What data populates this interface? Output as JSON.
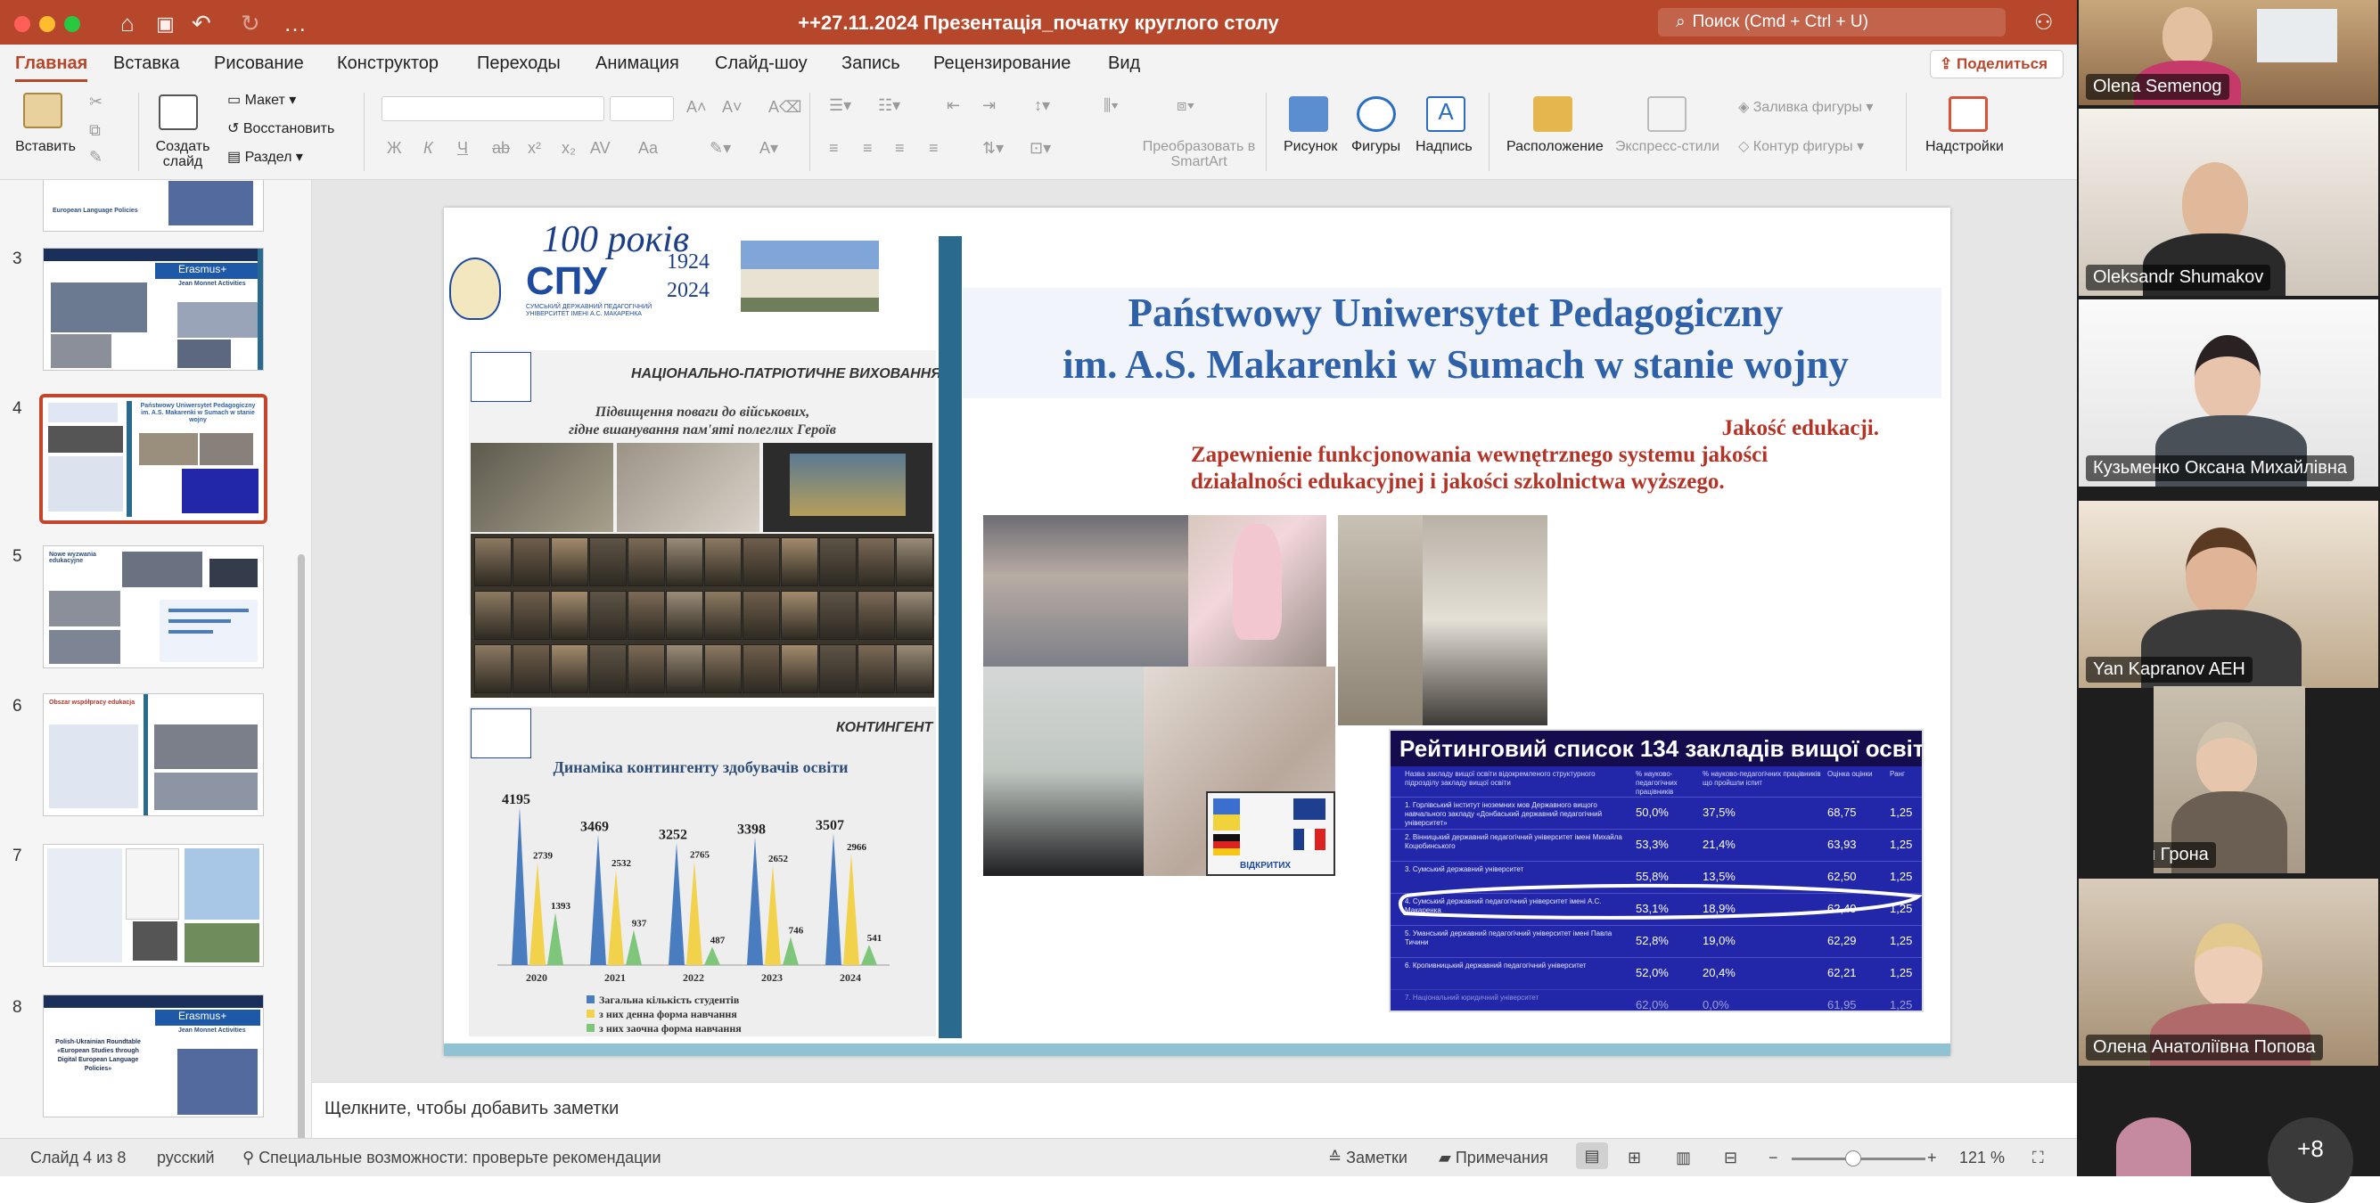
{
  "titlebar": {
    "title": "++27.11.2024 Презентація_початку круглого столу",
    "search_placeholder": "Поиск (Cmd + Ctrl + U)"
  },
  "tabs": [
    "Главная",
    "Вставка",
    "Рисование",
    "Конструктор",
    "Переходы",
    "Анимация",
    "Слайд-шоу",
    "Запись",
    "Рецензирование",
    "Вид"
  ],
  "active_tab": "Главная",
  "share_label": "Поделиться",
  "ribbon": {
    "paste": "Вставить",
    "new_slide": "Создать слайд",
    "layout": "Макет",
    "reset": "Восстановить",
    "section": "Раздел",
    "convert_smartart": "Преобразовать в SmartArt",
    "picture": "Рисунок",
    "shapes": "Фигуры",
    "textbox": "Надпись",
    "arrange": "Расположение",
    "quick_styles": "Экспресс-стили",
    "shape_fill": "Заливка фигуры",
    "shape_outline": "Контур фигуры",
    "addins": "Надстройки",
    "font_buttons": [
      "Ж",
      "К",
      "Ч",
      "ab",
      "x²",
      "x₂",
      "AV",
      "Aa"
    ]
  },
  "thumbnails": {
    "numbers": [
      "3",
      "4",
      "5",
      "6",
      "7",
      "8"
    ],
    "selected": "4",
    "erasmus_label": "Erasmus+",
    "erasmus_sub": "Jean Monnet Activities",
    "top_partial_text": "European Language Policies",
    "slide4_title": "Państwowy Uniwersytet Pedagogiczny im. A.S. Makarenki w Sumach w stanie wojny",
    "slide5_title": "Nowe wyzwania edukacyjne",
    "slide6_title": "Obszar współpracy edukacja",
    "slide8_text": "Polish-Ukrainian Roundtable «European Studies through Digital European Language Policies»"
  },
  "slide": {
    "title_line1": "Państwowy Uniwersytet Pedagogiczny",
    "title_line2": "im. A.S. Makarenki w Sumach  w stanie wojny",
    "subtitle_line1": "Jakość edukacji.",
    "subtitle_line2": "Zapewnienie funkcjonowania wewnętrznego systemu jakości",
    "subtitle_line3": "działalności edukacyjnej i jakości szkolnictwa wyższego.",
    "logo_100": "100 років",
    "logo_spu": "СПУ",
    "logo_years": [
      "1924",
      "2024"
    ],
    "logo_small": "СУМСЬКИЙ ДЕРЖАВНИЙ ПЕДАГОГІЧНИЙ УНІВЕРСИТЕТ ІМЕНІ А.С. МАКАРЕНКА",
    "panel1_header": "НАЦІОНАЛЬНО-ПАТРІОТИЧНЕ ВИХОВАННЯ",
    "panel1_text_1": "Підвищення поваги до військових,",
    "panel1_text_2": "гідне вшанування пам'яті полеглих Героїв",
    "panel2_header": "КОНТИНГЕНТ",
    "doors_label": "ВІДКРИТИХ"
  },
  "chart_data": {
    "type": "bar",
    "title": "Динаміка контингенту здобувачів освіти",
    "categories": [
      "2020",
      "2021",
      "2022",
      "2023",
      "2024"
    ],
    "series": [
      {
        "name": "Загальна кількість студентів",
        "values": [
          4195,
          3469,
          3252,
          3398,
          3507
        ],
        "color": "#4a7cc0"
      },
      {
        "name": "з них денна форма навчання",
        "values": [
          2739,
          2532,
          2765,
          2652,
          2966
        ],
        "color": "#f2d24b"
      },
      {
        "name": "з них заочна форма навчання",
        "values": [
          1393,
          937,
          487,
          746,
          541
        ],
        "color": "#7ec77a"
      }
    ],
    "ylim": [
      0,
      4500
    ]
  },
  "rating_table": {
    "title": "Рейтинговий список 134 закладів вищої освіти",
    "headers": [
      "Назва закладу вищої освіти відокремленого структурного підрозділу закладу вищої освіти",
      "% науково-педагогічних працівників",
      "% науково-педагогічних працівників що пройшли іспит",
      "Оцінка оцінки",
      "Ранг"
    ],
    "rows": [
      {
        "name": "1. Горлівський інститут іноземних мов Державного вищого навчального закладу «Донбаський державний педагогічний університет»",
        "c1": "50,0%",
        "c2": "37,5%",
        "c3": "68,75",
        "c4": "1,25"
      },
      {
        "name": "2. Вінницький державний педагогічний університет імені Михайла Коцюбинського",
        "c1": "53,3%",
        "c2": "21,4%",
        "c3": "63,93",
        "c4": "1,25"
      },
      {
        "name": "3. Сумський державний університет",
        "c1": "55,8%",
        "c2": "13,5%",
        "c3": "62,50",
        "c4": "1,25"
      },
      {
        "name": "4. Сумський державний педагогічний університет імені А.С. Макаренка",
        "c1": "53,1%",
        "c2": "18,9%",
        "c3": "62,40",
        "c4": "1,25"
      },
      {
        "name": "5. Уманський державний педагогічний університет імені Павла Тичини",
        "c1": "52,8%",
        "c2": "19,0%",
        "c3": "62,29",
        "c4": "1,25"
      },
      {
        "name": "6. Кропивницький державний педагогічний університет",
        "c1": "52,0%",
        "c2": "20,4%",
        "c3": "62,21",
        "c4": "1,25"
      },
      {
        "name": "7. Національний юридичний університет",
        "c1": "62,0%",
        "c2": "0,0%",
        "c3": "61,95",
        "c4": "1,25"
      }
    ]
  },
  "notes_placeholder": "Щелкните, чтобы добавить заметки",
  "status": {
    "slide_counter": "Слайд 4 из 8",
    "language": "русский",
    "accessibility": "Специальные возможности: проверьте рекомендации",
    "notes": "Заметки",
    "comments": "Примечания",
    "zoom": "121 %"
  },
  "participants": [
    {
      "name": "Olena Semenog"
    },
    {
      "name": "Oleksandr Shumakov"
    },
    {
      "name": "Кузьменко Оксана Михайлівна"
    },
    {
      "name": "Yan Kapranov AEH"
    },
    {
      "name": "Наталія Грона"
    },
    {
      "name": "Олена Анатоліївна Попова"
    }
  ],
  "more_participants": "+8"
}
